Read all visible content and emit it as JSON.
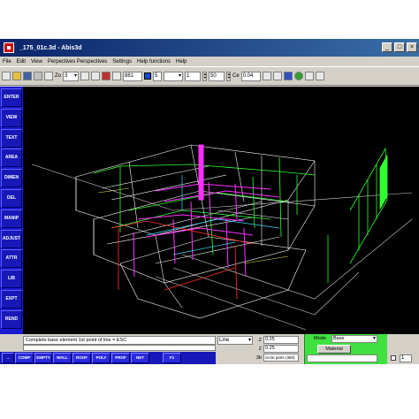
{
  "window": {
    "title": "_175_01c.3d - Abis3d"
  },
  "menu": [
    "File",
    "Edit",
    "View",
    "Perpectives Perspectives",
    "Settings",
    "Help functions",
    "Help"
  ],
  "toolbar": {
    "zo_label": "Zo",
    "zo_value": "3",
    "scale_field": "881",
    "color_value": "5",
    "mode_field": "",
    "field_one": "1",
    "field_fifty": "50",
    "ce_label": "Ce",
    "ce_value": "0.04"
  },
  "sidebar": [
    "ENTER",
    "VIEW",
    "TEXT",
    "AREA",
    "DIMEN",
    "DEL",
    "MANIP",
    "ADJUST",
    "ATTR",
    "LIB",
    "EXPT",
    "REND"
  ],
  "status": {
    "prompt": "Complete base element 1st point of line = ESC",
    "line_select": "Line",
    "z_label_a": "Z",
    "z_value_a": "0.25",
    "z_label_b": "Z",
    "z_value_b": "0.25",
    "length_label": "3b",
    "length_value": "circle parts (360)",
    "mode_label": "Mode",
    "mode_value": "Base",
    "material_button": "Material",
    "side_field": "1"
  },
  "bottom_tabs": [
    "COMP",
    "EMPTY",
    "WALL",
    "ROOF",
    "POLY",
    "PROF",
    "NET",
    "F1"
  ],
  "colors": {
    "sidebar_bg": "#1a1ad0",
    "viewport_bg": "#000000",
    "mode_panel": "#40e040",
    "wire_white": "#ffffff",
    "wire_green": "#30ff30",
    "wire_magenta": "#ff30ff",
    "wire_red": "#ff3030",
    "wire_cyan": "#40e0ff"
  }
}
